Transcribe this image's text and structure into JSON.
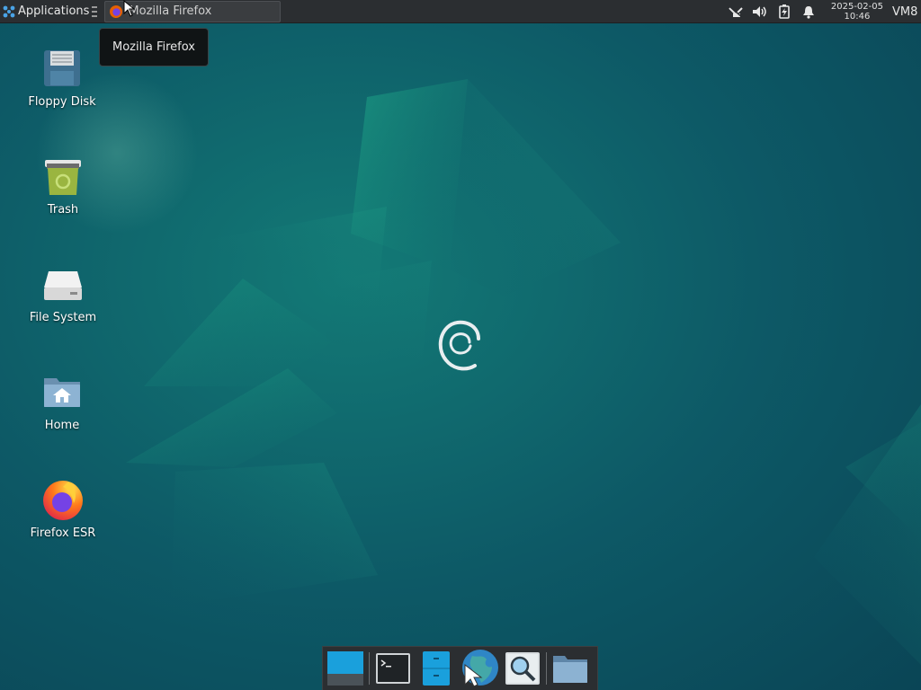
{
  "top_panel": {
    "applications_label": "Applications",
    "taskbar_window_title": "Mozilla Firefox",
    "clock_date": "2025-02-05",
    "clock_time": "10:46",
    "user_label": "VM8"
  },
  "tooltip": {
    "text": "Mozilla Firefox"
  },
  "desktop_icons": [
    {
      "label": "Floppy Disk",
      "icon": "floppy-disk-icon"
    },
    {
      "label": "Trash",
      "icon": "trash-icon"
    },
    {
      "label": "File System",
      "icon": "drive-icon"
    },
    {
      "label": "Home",
      "icon": "home-folder-icon"
    },
    {
      "label": "Firefox ESR",
      "icon": "firefox-icon"
    }
  ],
  "dock_items": [
    {
      "icon": "show-desktop-icon"
    },
    {
      "icon": "terminal-icon"
    },
    {
      "icon": "file-manager-icon"
    },
    {
      "icon": "web-browser-icon"
    },
    {
      "icon": "app-finder-icon"
    },
    {
      "icon": "folder-icon"
    }
  ],
  "colors": {
    "panel": "#2b2e31",
    "wallpaper_base": "#0c4f5e",
    "wallpaper_accent": "#1fa38a"
  }
}
